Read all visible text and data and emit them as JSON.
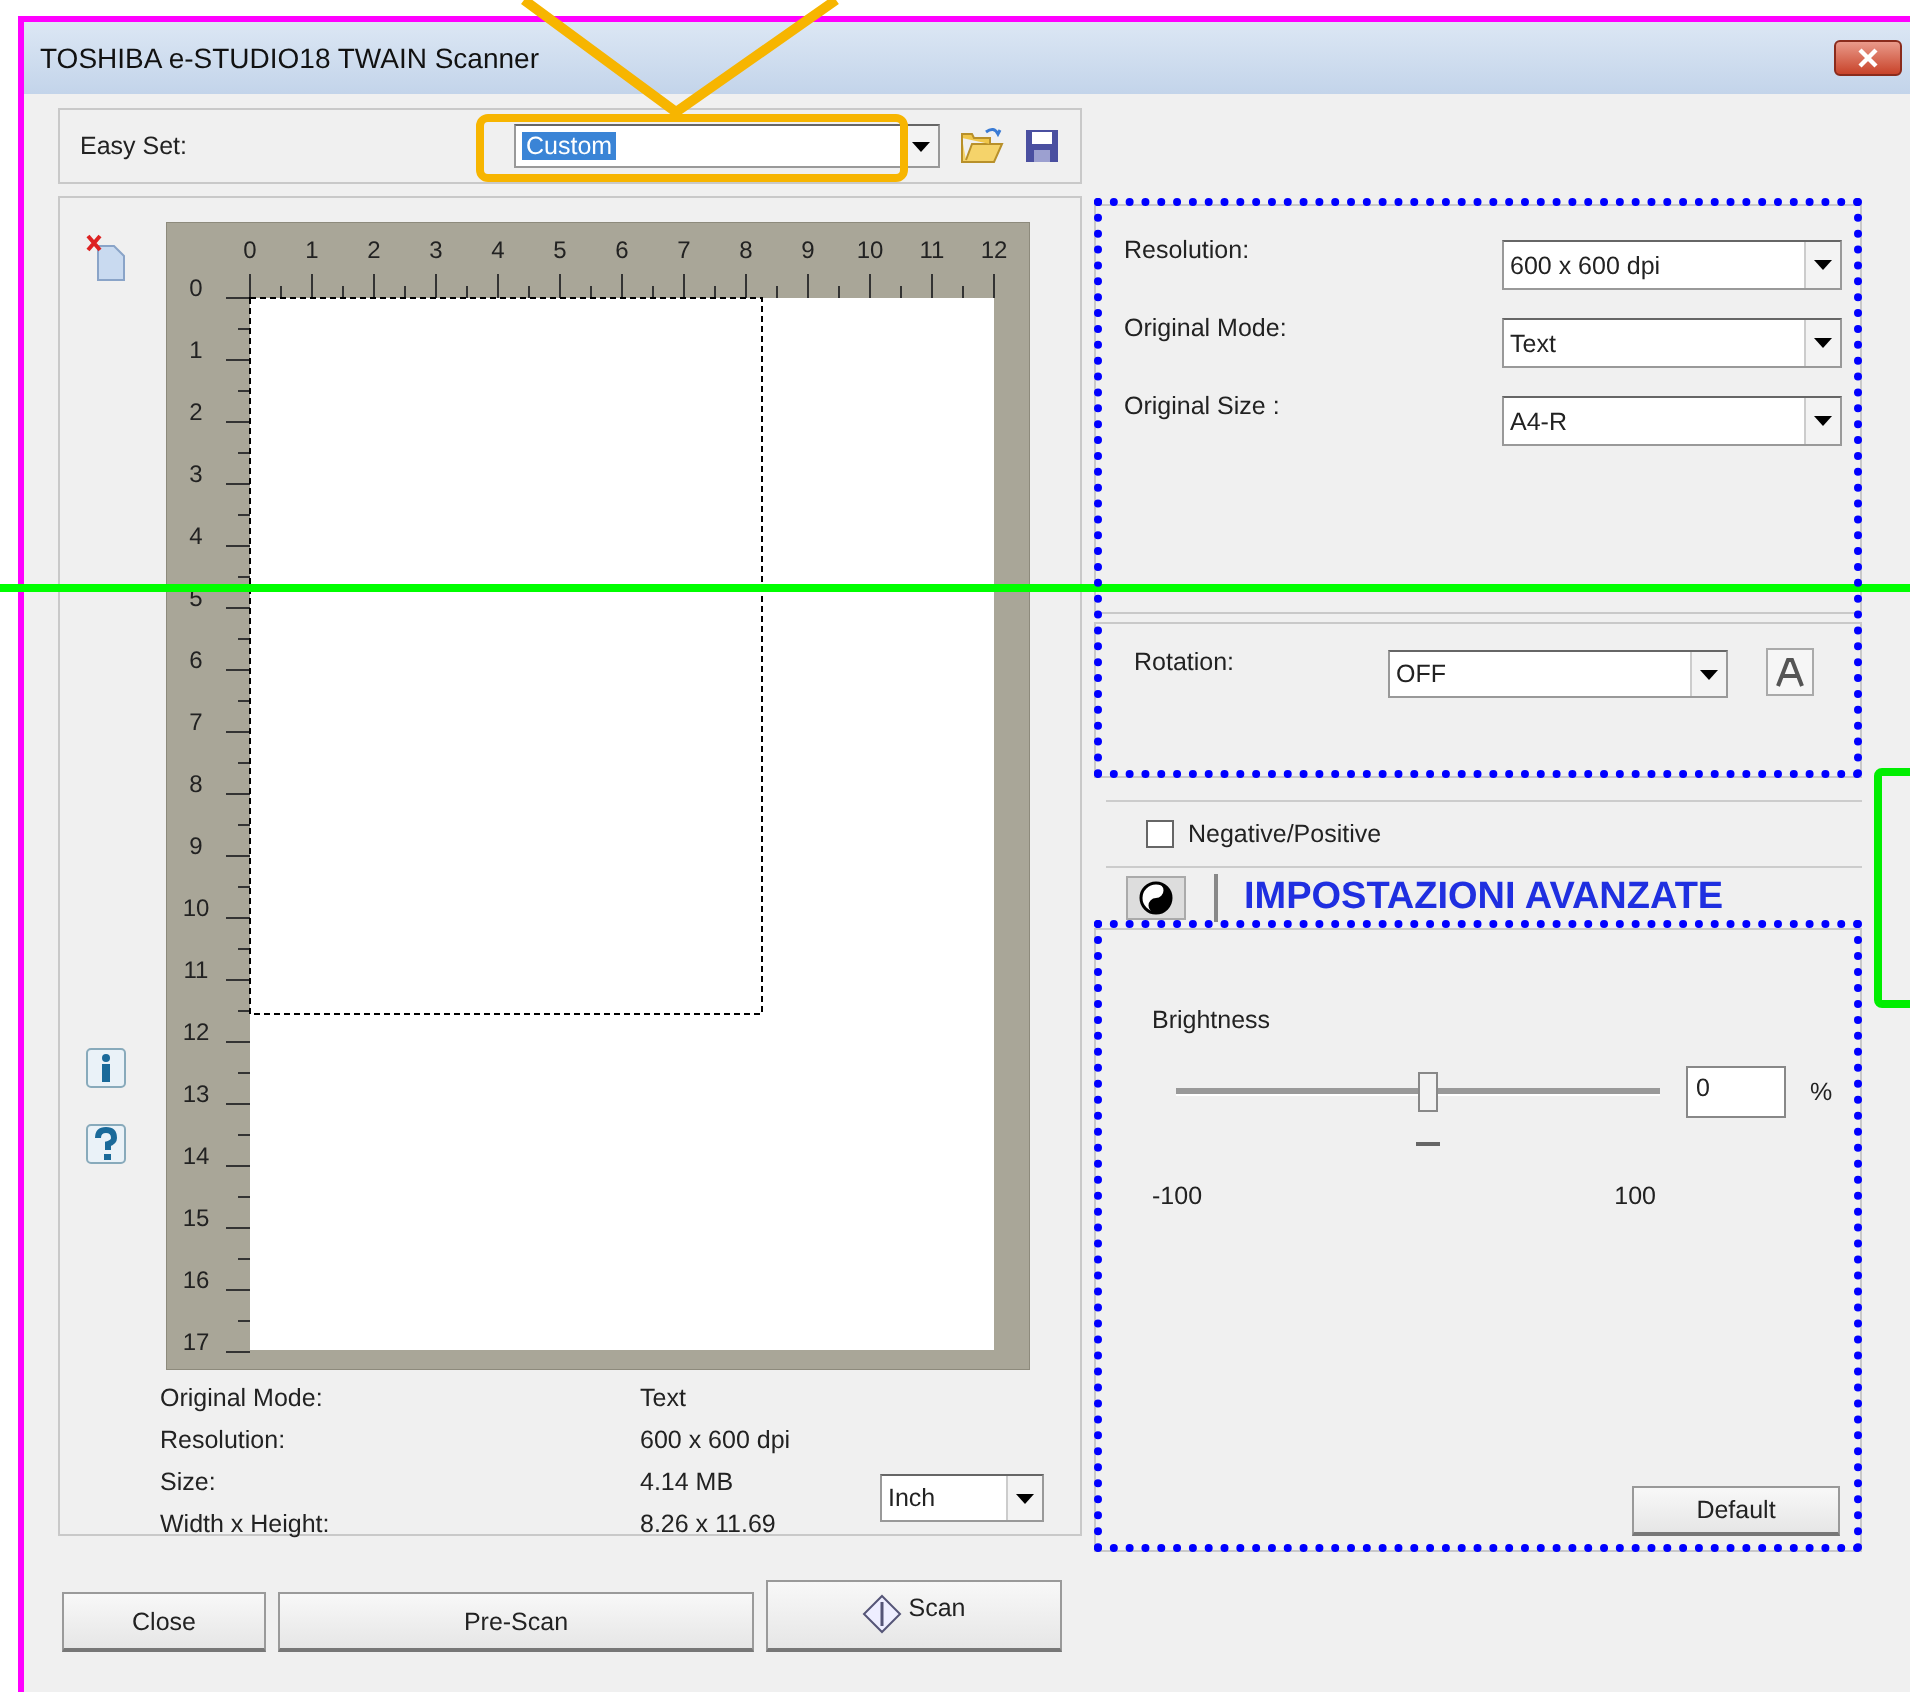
{
  "window": {
    "title": "TOSHIBA e-STUDIO18 TWAIN Scanner"
  },
  "easy_set": {
    "label": "Easy Set:",
    "value": "Custom"
  },
  "preview": {
    "x_labels": [
      "0",
      "1",
      "2",
      "3",
      "4",
      "5",
      "6",
      "7",
      "8",
      "9",
      "10",
      "11",
      "12"
    ],
    "y_labels": [
      "0",
      "1",
      "2",
      "3",
      "4",
      "5",
      "6",
      "7",
      "8",
      "9",
      "10",
      "11",
      "12",
      "13",
      "14",
      "15",
      "16",
      "17"
    ]
  },
  "info": [
    {
      "label": "Original Mode:",
      "value": "Text"
    },
    {
      "label": "Resolution:",
      "value": "600 x 600 dpi"
    },
    {
      "label": "Size:",
      "value": "4.14 MB"
    },
    {
      "label": "Width x Height:",
      "value": "8.26 x 11.69"
    }
  ],
  "unit": {
    "value": "Inch"
  },
  "settings": [
    {
      "label": "Resolution:",
      "value": "600 x 600 dpi"
    },
    {
      "label": "Original Mode:",
      "value": "Text"
    },
    {
      "label": "Original Size :",
      "value": "A4-R"
    }
  ],
  "rotation": {
    "label": "Rotation:",
    "value": "OFF"
  },
  "negative_positive": {
    "label": "Negative/Positive",
    "checked": false
  },
  "annotation": {
    "text": "IMPOSTAZIONI AVANZATE"
  },
  "brightness": {
    "label": "Brightness",
    "level": 0.52,
    "value": "0",
    "unit": "%",
    "min": "-100",
    "max": "100"
  },
  "default_button": "Default",
  "buttons": [
    {
      "kind": "plain",
      "label": "Close"
    },
    {
      "kind": "plain",
      "label": "Pre-Scan"
    },
    {
      "kind": "scan",
      "label": "Scan"
    }
  ]
}
